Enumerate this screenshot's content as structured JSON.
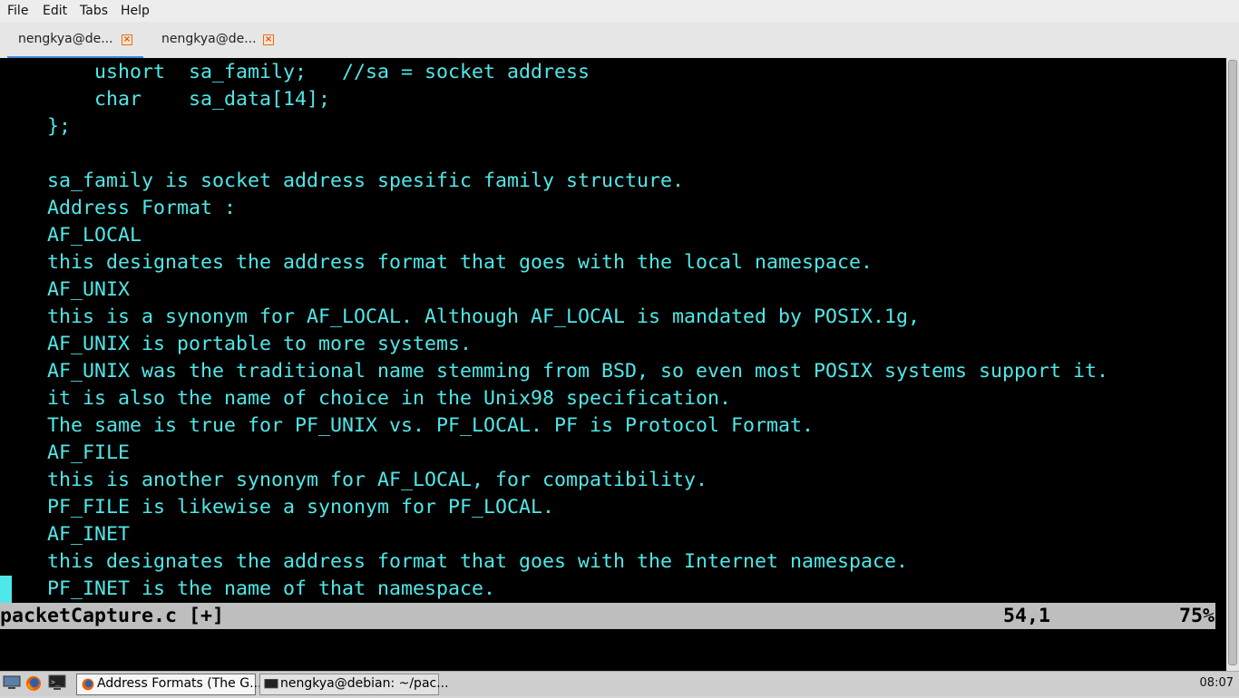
{
  "menu": [
    "File",
    "Edit",
    "Tabs",
    "Help"
  ],
  "tabs": [
    {
      "label": "nengkya@de...",
      "active": true
    },
    {
      "label": "nengkya@de...",
      "active": false
    }
  ],
  "terminal": {
    "lines": [
      "        ushort  sa_family;   //sa = socket address",
      "        char    sa_data[14];",
      "    };",
      "",
      "    sa_family is socket address spesific family structure.",
      "    Address Format :",
      "    AF_LOCAL",
      "    this designates the address format that goes with the local namespace.",
      "    AF_UNIX",
      "    this is a synonym for AF_LOCAL. Although AF_LOCAL is mandated by POSIX.1g,",
      "    AF_UNIX is portable to more systems.",
      "    AF_UNIX was the traditional name stemming from BSD, so even most POSIX systems support it.",
      "    it is also the name of choice in the Unix98 specification.",
      "    The same is true for PF_UNIX vs. PF_LOCAL. PF is Protocol Format.",
      "    AF_FILE",
      "    this is another synonym for AF_LOCAL, for compatibility.",
      "    PF_FILE is likewise a synonym for PF_LOCAL.",
      "    AF_INET",
      "    this designates the address format that goes with the Internet namespace.",
      "    PF_INET is the name of that namespace."
    ],
    "text_color": "#4fe8e8",
    "status": {
      "filename": "packetCapture.c [+]",
      "position": "54,1",
      "percent": "75%"
    }
  },
  "taskbar": {
    "launchers": [
      "show-desktop-icon",
      "firefox-icon",
      "terminal-icon"
    ],
    "tasks": [
      {
        "label": "Address Formats (The G...",
        "icon": "firefox-icon",
        "active": true
      },
      {
        "label": "nengkya@debian: ~/pac...",
        "icon": "terminal-icon",
        "active": false
      }
    ],
    "clock": "08:07"
  },
  "colors": {
    "tab_accent": "#3c8ad8",
    "close_accent": "#e07020",
    "terminal_bg": "#000000"
  }
}
